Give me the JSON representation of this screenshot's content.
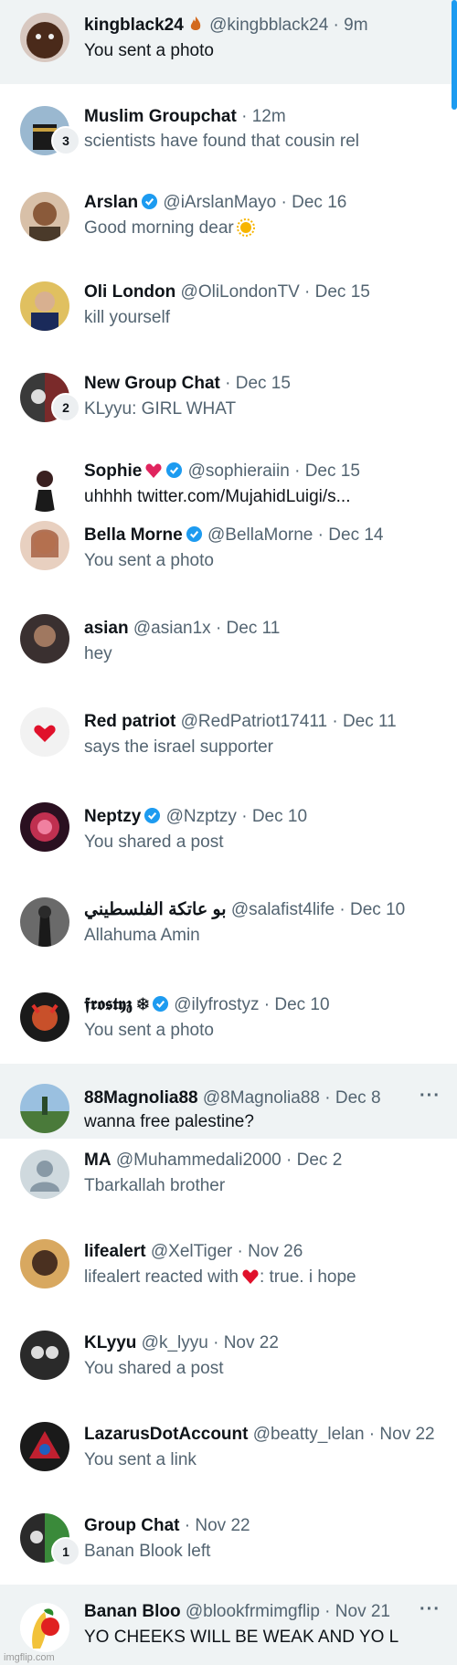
{
  "conversations": [
    {
      "name": "kingblack24",
      "handle": "@kingbblack24",
      "time": "9m",
      "preview": "You sent a photo",
      "avatar_color": "#7a4a2a"
    },
    {
      "name": "Muslim Groupchat",
      "handle": "",
      "time": "12m",
      "preview": "scientists have found that cousin rel",
      "badge": "3",
      "avatar_color": "#4a6a88"
    },
    {
      "name": "Arslan",
      "handle": "@iArslanMayo",
      "time": "Dec 16",
      "preview": "Good morning dear",
      "avatar_color": "#8a5a3a"
    },
    {
      "name": "Oli London",
      "handle": "@OliLondonTV",
      "time": "Dec 15",
      "preview": "kill yourself",
      "avatar_color": "#c8a060"
    },
    {
      "name": "New Group Chat",
      "handle": "",
      "time": "Dec 15",
      "preview": "KLyyu: GIRL WHAT",
      "badge": "2",
      "avatar_color": "#333333"
    },
    {
      "name": "Sophie",
      "handle": "@sophieraiin",
      "time": "Dec 15",
      "preview": "uhhhh twitter.com/MujahidLuigi/s...",
      "avatar_color": "#ffffff"
    },
    {
      "name": "Bella Morne",
      "handle": "@BellaMorne",
      "time": "Dec 14",
      "preview": "You sent a photo",
      "avatar_color": "#b0704a"
    },
    {
      "name": "asian",
      "handle": "@asian1x",
      "time": "Dec 11",
      "preview": "hey",
      "avatar_color": "#3a3030"
    },
    {
      "name": "Red patriot",
      "handle": "@RedPatriot17411",
      "time": "Dec 11",
      "preview": "says the israel supporter",
      "avatar_color": "#f2f2f2"
    },
    {
      "name": "Neptzy",
      "handle": "@Nzptzy",
      "time": "Dec 10",
      "preview": "You shared a post",
      "avatar_color": "#c03050"
    },
    {
      "name": "بو عاتكة الفلسطيني",
      "handle": "@salafist4life",
      "time": "Dec 10",
      "preview": "Allahuma Amin",
      "avatar_color": "#2a2a2a"
    },
    {
      "name": "𝖋𝖗𝖔𝖘𝖙𝖞𝖟 ❄",
      "handle": "@ilyfrostyz",
      "time": "Dec 10",
      "preview": "You sent a photo",
      "avatar_color": "#1a1a1a"
    },
    {
      "name": "88Magnolia88",
      "handle": "@8Magnolia88",
      "time": "Dec 8",
      "preview": "wanna free palestine?",
      "avatar_color": "#5a8a4a"
    },
    {
      "name": "MA",
      "handle": "@Muhammedali2000",
      "time": "Dec 2",
      "preview": "Tbarkallah brother",
      "avatar_color": "#cfd9de"
    },
    {
      "name": "lifealert",
      "handle": "@XelTiger",
      "time": "Nov 26",
      "preview_a": "lifealert reacted with",
      "preview_b": ": true. i hope",
      "avatar_color": "#8a6a40"
    },
    {
      "name": "KLyyu",
      "handle": "@k_lyyu",
      "time": "Nov 22",
      "preview": "You shared a post",
      "avatar_color": "#2a2a2a"
    },
    {
      "name": "LazarusDotAccount",
      "handle": "@beatty_lelan",
      "time": "Nov 22",
      "preview": "You sent a link",
      "avatar_color": "#c02030"
    },
    {
      "name": "Group Chat",
      "handle": "",
      "time": "Nov 22",
      "preview": "Banan Blook left",
      "badge": "1",
      "avatar_color": "#2a2a2a"
    },
    {
      "name": "Banan Bloo",
      "handle": "@blookfrmimgflip",
      "time": "Nov 21",
      "preview": "YO CHEEKS WILL BE WEAK AND YO L",
      "avatar_color": "#ffffff"
    }
  ],
  "ui": {
    "separator": "·",
    "more_label": "···",
    "watermark": "imgflip.com"
  },
  "colors": {
    "verified": "#1d9bf0",
    "secondary": "#536471",
    "highlight": "#eff3f4"
  }
}
